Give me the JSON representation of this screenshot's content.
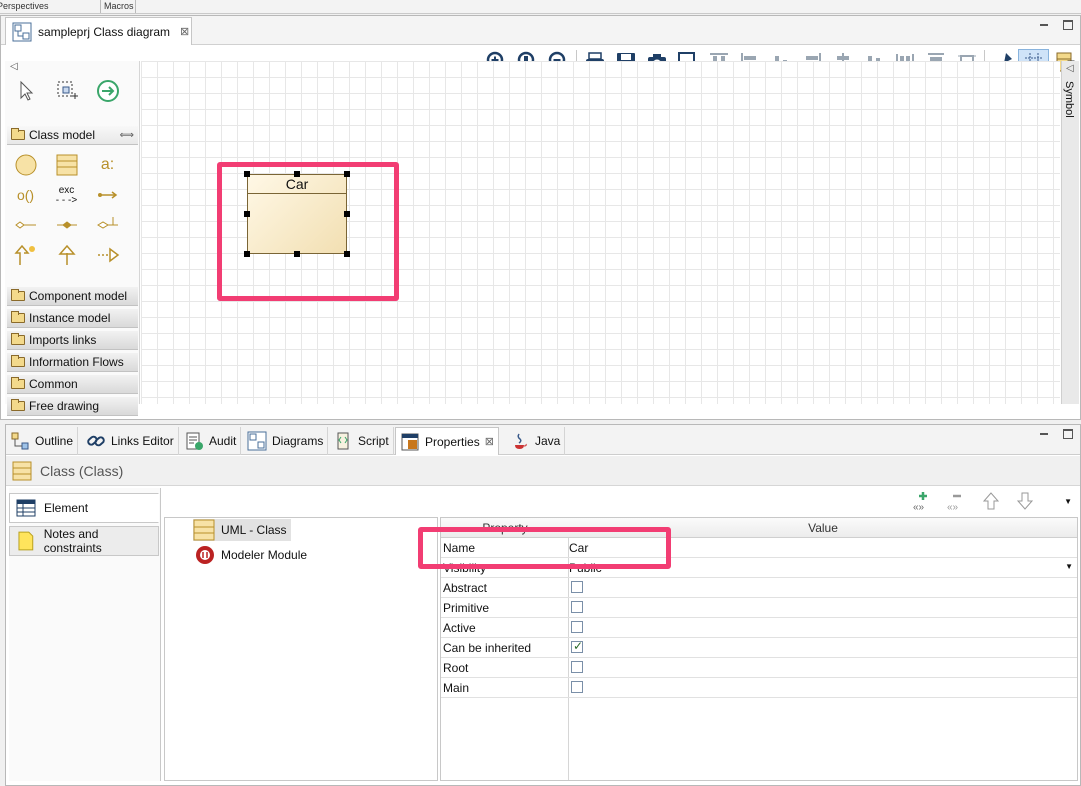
{
  "top_strip": {
    "perspectives": "Perspectives",
    "macros": "Macros"
  },
  "editor": {
    "tab_title": "sampleprj Class diagram",
    "toolbar_icons": [
      "zoom-in-icon",
      "zoom-fit-icon",
      "zoom-out-icon",
      "print-icon",
      "save-icon",
      "camera-icon",
      "select-area-icon",
      "align-top-icon",
      "align-left-icon",
      "align-bottom-icon",
      "align-right-icon",
      "center-horizontal-icon",
      "center-vertical-icon",
      "distribute-vertical-icon",
      "distribute-horizontal-icon",
      "resize-icon",
      "format-brush-icon",
      "grid-icon",
      "layout-icon"
    ]
  },
  "palette": {
    "sections": [
      {
        "label": "Class model",
        "open": true
      },
      {
        "label": "Component model"
      },
      {
        "label": "Instance model"
      },
      {
        "label": "Imports links"
      },
      {
        "label": "Information Flows"
      },
      {
        "label": "Common"
      },
      {
        "label": "Free drawing"
      }
    ],
    "exc_label": "exc",
    "attr_label": "a:",
    "op_label": "o()"
  },
  "diagram": {
    "class_name": "Car",
    "highlight_color": "#f23d73"
  },
  "symbol_bar": {
    "label": "Symbol"
  },
  "bottom": {
    "tabs": [
      "Outline",
      "Links Editor",
      "Audit",
      "Diagrams",
      "Script",
      "Properties",
      "Java"
    ],
    "active_tab": "Properties",
    "header": "Class (Class)",
    "left_tabs": [
      "Element",
      "Notes and constraints"
    ],
    "tree": [
      "UML - Class",
      "Modeler Module"
    ],
    "table": {
      "col_property": "Property",
      "col_value": "Value",
      "rows": [
        {
          "property": "Name",
          "value": "Car"
        },
        {
          "property": "Visibility",
          "value": "Public"
        },
        {
          "property": "Abstract",
          "checked": false
        },
        {
          "property": "Primitive",
          "checked": false
        },
        {
          "property": "Active",
          "checked": false
        },
        {
          "property": "Can be inherited",
          "checked": true
        },
        {
          "property": "Root",
          "checked": false
        },
        {
          "property": "Main",
          "checked": false
        }
      ]
    }
  }
}
